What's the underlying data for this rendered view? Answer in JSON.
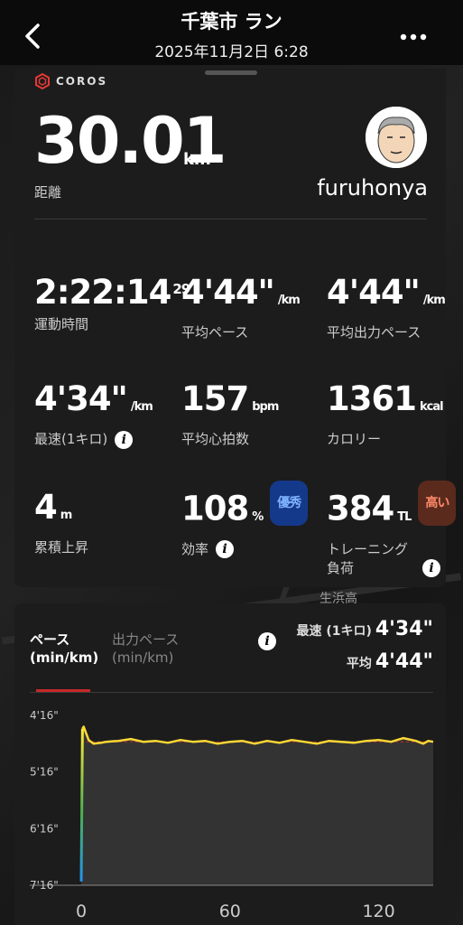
{
  "header": {
    "title": "千葉市 ラン",
    "datetime": "2025年11月2日 6:28"
  },
  "brand": {
    "logo_text": "COROS"
  },
  "summary": {
    "distance_value": "30.01",
    "distance_unit": "km",
    "distance_label": "距離",
    "username": "furuhonya"
  },
  "stats": {
    "duration": {
      "value": "2:22:14",
      "fraction": "29",
      "label": "運動時間"
    },
    "avg_pace": {
      "value": "4'44\"",
      "unit": "/km",
      "label": "平均ペース"
    },
    "avg_power_pace": {
      "value": "4'44\"",
      "unit": "/km",
      "label": "平均出力ペース"
    },
    "best_km": {
      "value": "4'34\"",
      "unit": "/km",
      "label": "最速(1キロ)"
    },
    "avg_hr": {
      "value": "157",
      "unit": "bpm",
      "label": "平均心拍数"
    },
    "calories": {
      "value": "1361",
      "unit": "kcal",
      "label": "カロリー"
    },
    "elevation": {
      "value": "4",
      "unit": "m",
      "label": "累積上昇"
    },
    "efficiency": {
      "value": "108",
      "unit": "%",
      "label": "効率",
      "badge": "優秀"
    },
    "training_load": {
      "value": "384",
      "unit": "TL",
      "label_line1": "トレーニング",
      "label_line2": "負荷",
      "badge": "高い"
    }
  },
  "map": {
    "label": "生浜高"
  },
  "chart_panel": {
    "tab_pace_line1": "ペース",
    "tab_pace_line2": "(min/km)",
    "tab_power_line1": "出力ペース",
    "tab_power_line2": "(min/km)",
    "best_label": "最速 (1キロ)",
    "best_value": "4'34\"",
    "avg_label": "平均",
    "avg_value": "4'44\""
  },
  "chart_data": {
    "type": "area",
    "y_ticks": [
      "4'16\"",
      "5'16\"",
      "6'16\"",
      "7'16\""
    ],
    "y_tick_values": [
      256,
      316,
      376,
      436
    ],
    "x_ticks": [
      "0",
      "60",
      "120"
    ],
    "x_tick_values": [
      0,
      60,
      120
    ],
    "xlim": [
      0,
      142
    ],
    "ylim_seconds_per_km": [
      256,
      436
    ],
    "average_line_seconds_per_km": 284,
    "series": [
      {
        "x": [
          0,
          0.5,
          1,
          3,
          5,
          8,
          10,
          15,
          20,
          25,
          30,
          35,
          40,
          45,
          50,
          55,
          60,
          65,
          70,
          75,
          80,
          85,
          90,
          95,
          100,
          105,
          110,
          115,
          120,
          125,
          130,
          135,
          138,
          140,
          142
        ],
        "values": [
          432,
          270,
          268,
          282,
          286,
          285,
          284,
          283,
          281,
          284,
          283,
          285,
          282,
          284,
          283,
          286,
          284,
          283,
          286,
          283,
          285,
          282,
          284,
          286,
          283,
          284,
          285,
          283,
          282,
          284,
          280,
          283,
          286,
          283,
          284
        ]
      }
    ]
  }
}
